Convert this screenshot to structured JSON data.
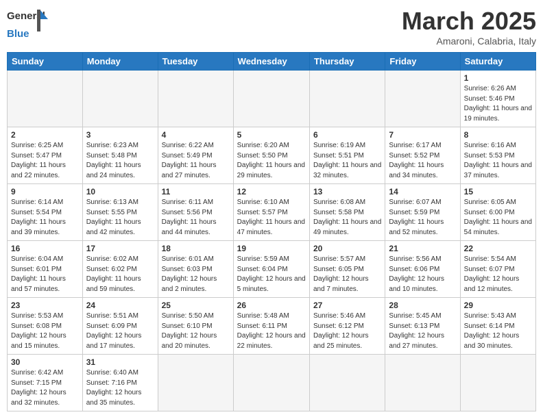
{
  "header": {
    "logo_general": "General",
    "logo_blue": "Blue",
    "month_title": "March 2025",
    "subtitle": "Amaroni, Calabria, Italy"
  },
  "days_of_week": [
    "Sunday",
    "Monday",
    "Tuesday",
    "Wednesday",
    "Thursday",
    "Friday",
    "Saturday"
  ],
  "weeks": [
    [
      {
        "day": "",
        "info": ""
      },
      {
        "day": "",
        "info": ""
      },
      {
        "day": "",
        "info": ""
      },
      {
        "day": "",
        "info": ""
      },
      {
        "day": "",
        "info": ""
      },
      {
        "day": "",
        "info": ""
      },
      {
        "day": "1",
        "info": "Sunrise: 6:26 AM\nSunset: 5:46 PM\nDaylight: 11 hours and 19 minutes."
      }
    ],
    [
      {
        "day": "2",
        "info": "Sunrise: 6:25 AM\nSunset: 5:47 PM\nDaylight: 11 hours and 22 minutes."
      },
      {
        "day": "3",
        "info": "Sunrise: 6:23 AM\nSunset: 5:48 PM\nDaylight: 11 hours and 24 minutes."
      },
      {
        "day": "4",
        "info": "Sunrise: 6:22 AM\nSunset: 5:49 PM\nDaylight: 11 hours and 27 minutes."
      },
      {
        "day": "5",
        "info": "Sunrise: 6:20 AM\nSunset: 5:50 PM\nDaylight: 11 hours and 29 minutes."
      },
      {
        "day": "6",
        "info": "Sunrise: 6:19 AM\nSunset: 5:51 PM\nDaylight: 11 hours and 32 minutes."
      },
      {
        "day": "7",
        "info": "Sunrise: 6:17 AM\nSunset: 5:52 PM\nDaylight: 11 hours and 34 minutes."
      },
      {
        "day": "8",
        "info": "Sunrise: 6:16 AM\nSunset: 5:53 PM\nDaylight: 11 hours and 37 minutes."
      }
    ],
    [
      {
        "day": "9",
        "info": "Sunrise: 6:14 AM\nSunset: 5:54 PM\nDaylight: 11 hours and 39 minutes."
      },
      {
        "day": "10",
        "info": "Sunrise: 6:13 AM\nSunset: 5:55 PM\nDaylight: 11 hours and 42 minutes."
      },
      {
        "day": "11",
        "info": "Sunrise: 6:11 AM\nSunset: 5:56 PM\nDaylight: 11 hours and 44 minutes."
      },
      {
        "day": "12",
        "info": "Sunrise: 6:10 AM\nSunset: 5:57 PM\nDaylight: 11 hours and 47 minutes."
      },
      {
        "day": "13",
        "info": "Sunrise: 6:08 AM\nSunset: 5:58 PM\nDaylight: 11 hours and 49 minutes."
      },
      {
        "day": "14",
        "info": "Sunrise: 6:07 AM\nSunset: 5:59 PM\nDaylight: 11 hours and 52 minutes."
      },
      {
        "day": "15",
        "info": "Sunrise: 6:05 AM\nSunset: 6:00 PM\nDaylight: 11 hours and 54 minutes."
      }
    ],
    [
      {
        "day": "16",
        "info": "Sunrise: 6:04 AM\nSunset: 6:01 PM\nDaylight: 11 hours and 57 minutes."
      },
      {
        "day": "17",
        "info": "Sunrise: 6:02 AM\nSunset: 6:02 PM\nDaylight: 11 hours and 59 minutes."
      },
      {
        "day": "18",
        "info": "Sunrise: 6:01 AM\nSunset: 6:03 PM\nDaylight: 12 hours and 2 minutes."
      },
      {
        "day": "19",
        "info": "Sunrise: 5:59 AM\nSunset: 6:04 PM\nDaylight: 12 hours and 5 minutes."
      },
      {
        "day": "20",
        "info": "Sunrise: 5:57 AM\nSunset: 6:05 PM\nDaylight: 12 hours and 7 minutes."
      },
      {
        "day": "21",
        "info": "Sunrise: 5:56 AM\nSunset: 6:06 PM\nDaylight: 12 hours and 10 minutes."
      },
      {
        "day": "22",
        "info": "Sunrise: 5:54 AM\nSunset: 6:07 PM\nDaylight: 12 hours and 12 minutes."
      }
    ],
    [
      {
        "day": "23",
        "info": "Sunrise: 5:53 AM\nSunset: 6:08 PM\nDaylight: 12 hours and 15 minutes."
      },
      {
        "day": "24",
        "info": "Sunrise: 5:51 AM\nSunset: 6:09 PM\nDaylight: 12 hours and 17 minutes."
      },
      {
        "day": "25",
        "info": "Sunrise: 5:50 AM\nSunset: 6:10 PM\nDaylight: 12 hours and 20 minutes."
      },
      {
        "day": "26",
        "info": "Sunrise: 5:48 AM\nSunset: 6:11 PM\nDaylight: 12 hours and 22 minutes."
      },
      {
        "day": "27",
        "info": "Sunrise: 5:46 AM\nSunset: 6:12 PM\nDaylight: 12 hours and 25 minutes."
      },
      {
        "day": "28",
        "info": "Sunrise: 5:45 AM\nSunset: 6:13 PM\nDaylight: 12 hours and 27 minutes."
      },
      {
        "day": "29",
        "info": "Sunrise: 5:43 AM\nSunset: 6:14 PM\nDaylight: 12 hours and 30 minutes."
      }
    ],
    [
      {
        "day": "30",
        "info": "Sunrise: 6:42 AM\nSunset: 7:15 PM\nDaylight: 12 hours and 32 minutes."
      },
      {
        "day": "31",
        "info": "Sunrise: 6:40 AM\nSunset: 7:16 PM\nDaylight: 12 hours and 35 minutes."
      },
      {
        "day": "",
        "info": ""
      },
      {
        "day": "",
        "info": ""
      },
      {
        "day": "",
        "info": ""
      },
      {
        "day": "",
        "info": ""
      },
      {
        "day": "",
        "info": ""
      }
    ]
  ]
}
